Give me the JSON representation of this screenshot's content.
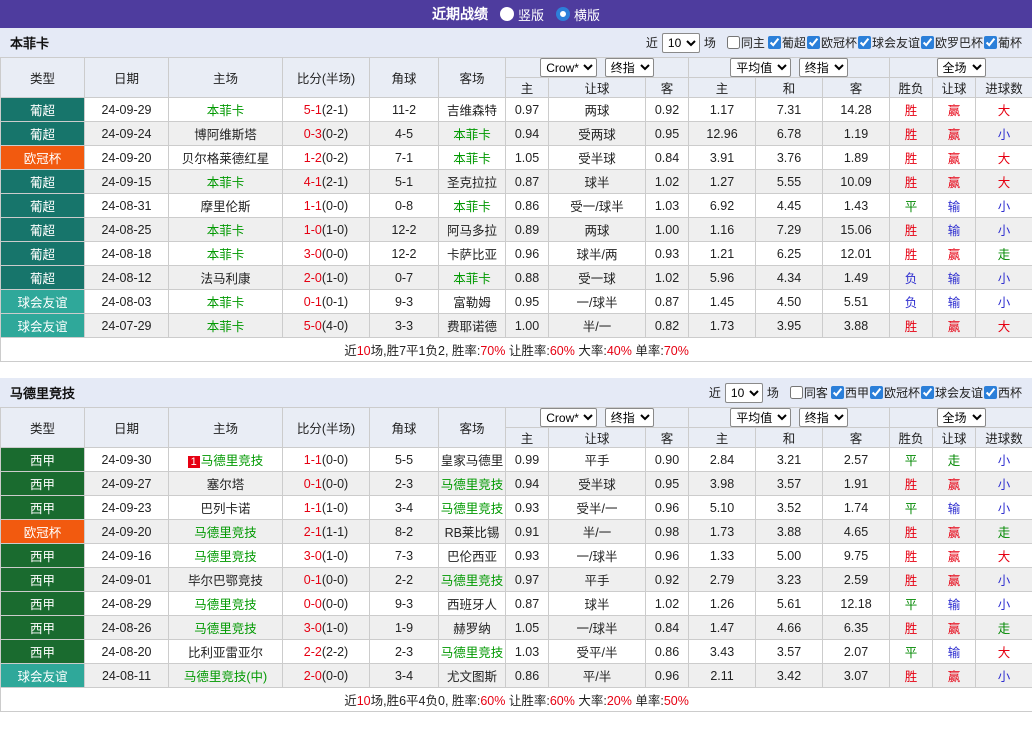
{
  "titlebar": {
    "title": "近期战绩",
    "options": [
      {
        "label": "竖版",
        "selected": false
      },
      {
        "label": "横版",
        "selected": true
      }
    ]
  },
  "table_header": {
    "cols": [
      "类型",
      "日期",
      "主场",
      "比分(半场)",
      "角球",
      "客场"
    ],
    "sub": [
      "主",
      "让球",
      "客",
      "主",
      "和",
      "客",
      "胜负",
      "让球",
      "进球数"
    ],
    "selects": {
      "source": "Crow*",
      "final1": "终指",
      "average": "平均值",
      "final2": "终指",
      "scope": "全场"
    }
  },
  "league_colors": {
    "葡超": "#17756b",
    "欧冠杯": "#f25a0f",
    "球会友谊": "#2fa89a",
    "西甲": "#1a6b2f"
  },
  "result_colors": {
    "r": "#e60012",
    "g": "#008800",
    "b": "#2f2fd0"
  },
  "sections": [
    {
      "team": "本菲卡",
      "filter": {
        "near": "近",
        "games": "10",
        "games_unit": "场",
        "same": "同主",
        "same_checked": false,
        "leagues": [
          "葡超",
          "欧冠杯",
          "球会友谊",
          "欧罗巴杯",
          "葡杯"
        ]
      },
      "rows": [
        {
          "league": "葡超",
          "date": "24-09-29",
          "home": "本菲卡",
          "home_focal": true,
          "rank": "",
          "score": "5-1",
          "half": "(2-1)",
          "corner": "11-2",
          "away": "吉维森特",
          "away_focal": false,
          "crow": [
            "0.97",
            "两球",
            "0.92"
          ],
          "avg": [
            "1.17",
            "7.31",
            "14.28"
          ],
          "res": [
            [
              "胜",
              "r"
            ],
            [
              "赢",
              "r"
            ],
            [
              "大",
              "r"
            ]
          ]
        },
        {
          "league": "葡超",
          "date": "24-09-24",
          "home": "博阿维斯塔",
          "home_focal": false,
          "rank": "",
          "score": "0-3",
          "half": "(0-2)",
          "corner": "4-5",
          "away": "本菲卡",
          "away_focal": true,
          "crow": [
            "0.94",
            "受两球",
            "0.95"
          ],
          "avg": [
            "12.96",
            "6.78",
            "1.19"
          ],
          "res": [
            [
              "胜",
              "r"
            ],
            [
              "赢",
              "r"
            ],
            [
              "小",
              "b"
            ]
          ]
        },
        {
          "league": "欧冠杯",
          "date": "24-09-20",
          "home": "贝尔格莱德红星",
          "home_focal": false,
          "rank": "",
          "score": "1-2",
          "half": "(0-2)",
          "corner": "7-1",
          "away": "本菲卡",
          "away_focal": true,
          "crow": [
            "1.05",
            "受半球",
            "0.84"
          ],
          "avg": [
            "3.91",
            "3.76",
            "1.89"
          ],
          "res": [
            [
              "胜",
              "r"
            ],
            [
              "赢",
              "r"
            ],
            [
              "大",
              "r"
            ]
          ]
        },
        {
          "league": "葡超",
          "date": "24-09-15",
          "home": "本菲卡",
          "home_focal": true,
          "rank": "",
          "score": "4-1",
          "half": "(2-1)",
          "corner": "5-1",
          "away": "圣克拉拉",
          "away_focal": false,
          "crow": [
            "0.87",
            "球半",
            "1.02"
          ],
          "avg": [
            "1.27",
            "5.55",
            "10.09"
          ],
          "res": [
            [
              "胜",
              "r"
            ],
            [
              "赢",
              "r"
            ],
            [
              "大",
              "r"
            ]
          ]
        },
        {
          "league": "葡超",
          "date": "24-08-31",
          "home": "摩里伦斯",
          "home_focal": false,
          "rank": "",
          "score": "1-1",
          "half": "(0-0)",
          "corner": "0-8",
          "away": "本菲卡",
          "away_focal": true,
          "crow": [
            "0.86",
            "受一/球半",
            "1.03"
          ],
          "avg": [
            "6.92",
            "4.45",
            "1.43"
          ],
          "res": [
            [
              "平",
              "g"
            ],
            [
              "输",
              "b"
            ],
            [
              "小",
              "b"
            ]
          ]
        },
        {
          "league": "葡超",
          "date": "24-08-25",
          "home": "本菲卡",
          "home_focal": true,
          "rank": "",
          "score": "1-0",
          "half": "(1-0)",
          "corner": "12-2",
          "away": "阿马多拉",
          "away_focal": false,
          "crow": [
            "0.89",
            "两球",
            "1.00"
          ],
          "avg": [
            "1.16",
            "7.29",
            "15.06"
          ],
          "res": [
            [
              "胜",
              "r"
            ],
            [
              "输",
              "b"
            ],
            [
              "小",
              "b"
            ]
          ]
        },
        {
          "league": "葡超",
          "date": "24-08-18",
          "home": "本菲卡",
          "home_focal": true,
          "rank": "",
          "score": "3-0",
          "half": "(0-0)",
          "corner": "12-2",
          "away": "卡萨比亚",
          "away_focal": false,
          "crow": [
            "0.96",
            "球半/两",
            "0.93"
          ],
          "avg": [
            "1.21",
            "6.25",
            "12.01"
          ],
          "res": [
            [
              "胜",
              "r"
            ],
            [
              "赢",
              "r"
            ],
            [
              "走",
              "g"
            ]
          ]
        },
        {
          "league": "葡超",
          "date": "24-08-12",
          "home": "法马利康",
          "home_focal": false,
          "rank": "",
          "score": "2-0",
          "half": "(1-0)",
          "corner": "0-7",
          "away": "本菲卡",
          "away_focal": true,
          "crow": [
            "0.88",
            "受一球",
            "1.02"
          ],
          "avg": [
            "5.96",
            "4.34",
            "1.49"
          ],
          "res": [
            [
              "负",
              "b"
            ],
            [
              "输",
              "b"
            ],
            [
              "小",
              "b"
            ]
          ]
        },
        {
          "league": "球会友谊",
          "date": "24-08-03",
          "home": "本菲卡",
          "home_focal": true,
          "rank": "",
          "score": "0-1",
          "half": "(0-1)",
          "corner": "9-3",
          "away": "富勒姆",
          "away_focal": false,
          "crow": [
            "0.95",
            "一/球半",
            "0.87"
          ],
          "avg": [
            "1.45",
            "4.50",
            "5.51"
          ],
          "res": [
            [
              "负",
              "b"
            ],
            [
              "输",
              "b"
            ],
            [
              "小",
              "b"
            ]
          ]
        },
        {
          "league": "球会友谊",
          "date": "24-07-29",
          "home": "本菲卡",
          "home_focal": true,
          "rank": "",
          "score": "5-0",
          "half": "(4-0)",
          "corner": "3-3",
          "away": "费耶诺德",
          "away_focal": false,
          "crow": [
            "1.00",
            "半/一",
            "0.82"
          ],
          "avg": [
            "1.73",
            "3.95",
            "3.88"
          ],
          "res": [
            [
              "胜",
              "r"
            ],
            [
              "赢",
              "r"
            ],
            [
              "大",
              "r"
            ]
          ]
        }
      ],
      "summary": [
        {
          "t": "近"
        },
        {
          "t": "10",
          "red": true
        },
        {
          "t": "场,胜7平1负2, 胜率:"
        },
        {
          "t": "70%",
          "red": true
        },
        {
          "t": " 让胜率:"
        },
        {
          "t": "60%",
          "red": true
        },
        {
          "t": " 大率:"
        },
        {
          "t": "40%",
          "red": true
        },
        {
          "t": " 单率:"
        },
        {
          "t": "70%",
          "red": true
        }
      ]
    },
    {
      "team": "马德里竞技",
      "filter": {
        "near": "近",
        "games": "10",
        "games_unit": "场",
        "same": "同客",
        "same_checked": false,
        "leagues": [
          "西甲",
          "欧冠杯",
          "球会友谊",
          "西杯"
        ]
      },
      "rows": [
        {
          "league": "西甲",
          "date": "24-09-30",
          "home": "马德里竞技",
          "home_focal": true,
          "rank": "1",
          "score": "1-1",
          "half": "(0-0)",
          "corner": "5-5",
          "away": "皇家马德里",
          "away_focal": false,
          "crow": [
            "0.99",
            "平手",
            "0.90"
          ],
          "avg": [
            "2.84",
            "3.21",
            "2.57"
          ],
          "res": [
            [
              "平",
              "g"
            ],
            [
              "走",
              "g"
            ],
            [
              "小",
              "b"
            ]
          ]
        },
        {
          "league": "西甲",
          "date": "24-09-27",
          "home": "塞尔塔",
          "home_focal": false,
          "rank": "",
          "score": "0-1",
          "half": "(0-0)",
          "corner": "2-3",
          "away": "马德里竞技",
          "away_focal": true,
          "crow": [
            "0.94",
            "受半球",
            "0.95"
          ],
          "avg": [
            "3.98",
            "3.57",
            "1.91"
          ],
          "res": [
            [
              "胜",
              "r"
            ],
            [
              "赢",
              "r"
            ],
            [
              "小",
              "b"
            ]
          ]
        },
        {
          "league": "西甲",
          "date": "24-09-23",
          "home": "巴列卡诺",
          "home_focal": false,
          "rank": "",
          "score": "1-1",
          "half": "(1-0)",
          "corner": "3-4",
          "away": "马德里竞技",
          "away_focal": true,
          "crow": [
            "0.93",
            "受半/一",
            "0.96"
          ],
          "avg": [
            "5.10",
            "3.52",
            "1.74"
          ],
          "res": [
            [
              "平",
              "g"
            ],
            [
              "输",
              "b"
            ],
            [
              "小",
              "b"
            ]
          ]
        },
        {
          "league": "欧冠杯",
          "date": "24-09-20",
          "home": "马德里竞技",
          "home_focal": true,
          "rank": "",
          "score": "2-1",
          "half": "(1-1)",
          "corner": "8-2",
          "away": "RB莱比锡",
          "away_focal": false,
          "crow": [
            "0.91",
            "半/一",
            "0.98"
          ],
          "avg": [
            "1.73",
            "3.88",
            "4.65"
          ],
          "res": [
            [
              "胜",
              "r"
            ],
            [
              "赢",
              "r"
            ],
            [
              "走",
              "g"
            ]
          ]
        },
        {
          "league": "西甲",
          "date": "24-09-16",
          "home": "马德里竞技",
          "home_focal": true,
          "rank": "",
          "score": "3-0",
          "half": "(1-0)",
          "corner": "7-3",
          "away": "巴伦西亚",
          "away_focal": false,
          "crow": [
            "0.93",
            "一/球半",
            "0.96"
          ],
          "avg": [
            "1.33",
            "5.00",
            "9.75"
          ],
          "res": [
            [
              "胜",
              "r"
            ],
            [
              "赢",
              "r"
            ],
            [
              "大",
              "r"
            ]
          ]
        },
        {
          "league": "西甲",
          "date": "24-09-01",
          "home": "毕尔巴鄂竞技",
          "home_focal": false,
          "rank": "",
          "score": "0-1",
          "half": "(0-0)",
          "corner": "2-2",
          "away": "马德里竞技",
          "away_focal": true,
          "crow": [
            "0.97",
            "平手",
            "0.92"
          ],
          "avg": [
            "2.79",
            "3.23",
            "2.59"
          ],
          "res": [
            [
              "胜",
              "r"
            ],
            [
              "赢",
              "r"
            ],
            [
              "小",
              "b"
            ]
          ]
        },
        {
          "league": "西甲",
          "date": "24-08-29",
          "home": "马德里竞技",
          "home_focal": true,
          "rank": "",
          "score": "0-0",
          "half": "(0-0)",
          "corner": "9-3",
          "away": "西班牙人",
          "away_focal": false,
          "crow": [
            "0.87",
            "球半",
            "1.02"
          ],
          "avg": [
            "1.26",
            "5.61",
            "12.18"
          ],
          "res": [
            [
              "平",
              "g"
            ],
            [
              "输",
              "b"
            ],
            [
              "小",
              "b"
            ]
          ]
        },
        {
          "league": "西甲",
          "date": "24-08-26",
          "home": "马德里竞技",
          "home_focal": true,
          "rank": "",
          "score": "3-0",
          "half": "(1-0)",
          "corner": "1-9",
          "away": "赫罗纳",
          "away_focal": false,
          "crow": [
            "1.05",
            "一/球半",
            "0.84"
          ],
          "avg": [
            "1.47",
            "4.66",
            "6.35"
          ],
          "res": [
            [
              "胜",
              "r"
            ],
            [
              "赢",
              "r"
            ],
            [
              "走",
              "g"
            ]
          ]
        },
        {
          "league": "西甲",
          "date": "24-08-20",
          "home": "比利亚雷亚尔",
          "home_focal": false,
          "rank": "",
          "score": "2-2",
          "half": "(2-2)",
          "corner": "2-3",
          "away": "马德里竞技",
          "away_focal": true,
          "crow": [
            "1.03",
            "受平/半",
            "0.86"
          ],
          "avg": [
            "3.43",
            "3.57",
            "2.07"
          ],
          "res": [
            [
              "平",
              "g"
            ],
            [
              "输",
              "b"
            ],
            [
              "大",
              "r"
            ]
          ]
        },
        {
          "league": "球会友谊",
          "date": "24-08-11",
          "home": "马德里竞技(中)",
          "home_focal": true,
          "rank": "",
          "score": "2-0",
          "half": "(0-0)",
          "corner": "3-4",
          "away": "尤文图斯",
          "away_focal": false,
          "crow": [
            "0.86",
            "平/半",
            "0.96"
          ],
          "avg": [
            "2.11",
            "3.42",
            "3.07"
          ],
          "res": [
            [
              "胜",
              "r"
            ],
            [
              "赢",
              "r"
            ],
            [
              "小",
              "b"
            ]
          ]
        }
      ],
      "summary": [
        {
          "t": "近"
        },
        {
          "t": "10",
          "red": true
        },
        {
          "t": "场,胜6平4负0, 胜率:"
        },
        {
          "t": "60%",
          "red": true
        },
        {
          "t": " 让胜率:"
        },
        {
          "t": "60%",
          "red": true
        },
        {
          "t": " 大率:"
        },
        {
          "t": "20%",
          "red": true
        },
        {
          "t": " 单率:"
        },
        {
          "t": "50%",
          "red": true
        }
      ]
    }
  ]
}
